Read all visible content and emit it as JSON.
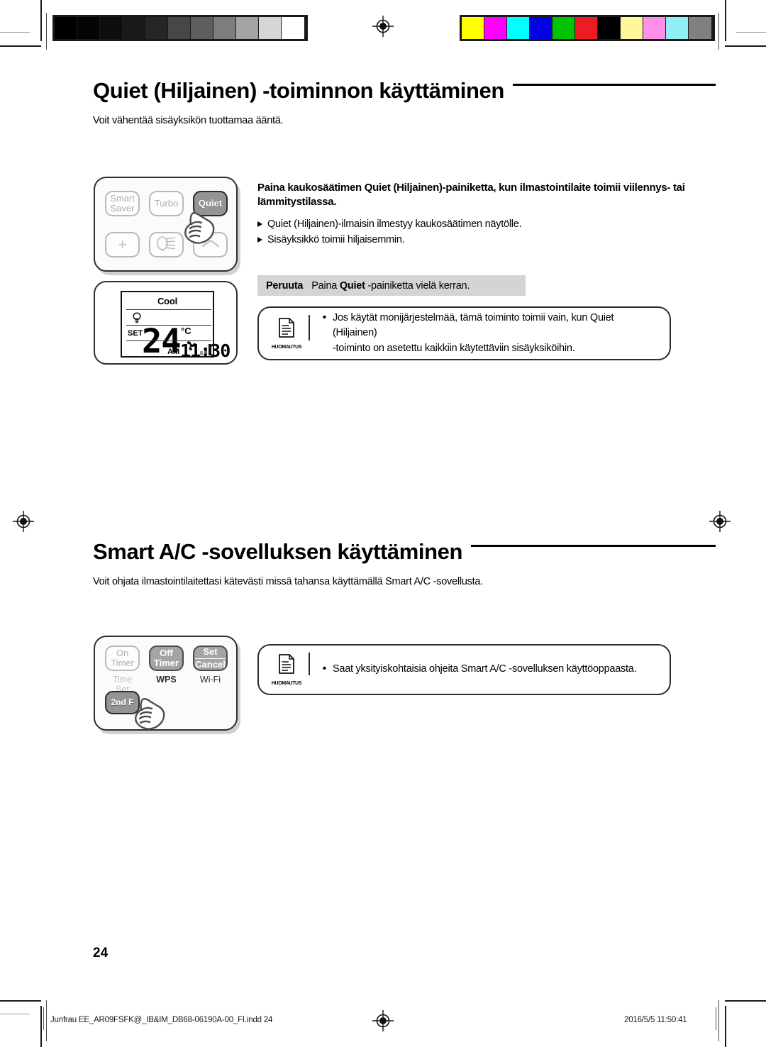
{
  "calibration": {
    "gray_patches": [
      "#000000",
      "#050505",
      "#0d0d0d",
      "#191919",
      "#262626",
      "#474747",
      "#5e5e5e",
      "#7d7d7d",
      "#a3a3a3",
      "#d6d6d6",
      "#ffffff"
    ],
    "color_patches": [
      "#ffff00",
      "#ff00ff",
      "#00ffff",
      "#0000e0",
      "#00c400",
      "#ed1c24",
      "#000000",
      "#fff79a",
      "#ff8fe8",
      "#8ff0f5",
      "#808080"
    ]
  },
  "sections": [
    {
      "id": "quiet",
      "title": "Quiet (Hiljainen) -toiminnon käyttäminen",
      "intro": "Voit vähentää sisäyksikön tuottamaa ääntä.",
      "remote": {
        "buttons_row1": [
          {
            "name": "smart-saver",
            "line1": "Smart",
            "line2": "Saver",
            "state": "inactive"
          },
          {
            "name": "turbo",
            "line1": "Turbo",
            "line2": "",
            "state": "inactive"
          },
          {
            "name": "quiet",
            "line1": "Quiet",
            "line2": "",
            "state": "pressed"
          }
        ],
        "buttons_row2": [
          {
            "name": "plus",
            "glyph": "+",
            "state": "inactive"
          },
          {
            "name": "swing",
            "glyph": "swing-icon",
            "state": "inactive"
          },
          {
            "name": "up",
            "glyph": "chevron-up-icon",
            "state": "inactive"
          }
        ]
      },
      "lcd": {
        "mode": "Cool",
        "indicator": "quiet-indicator-icon",
        "set_label": "SET",
        "temperature": "24",
        "unit": "°C",
        "fan": "fan-icon",
        "fan_level_bars": 3,
        "ampm": "AM",
        "clock": "11:30"
      },
      "lead": "Paina kaukosäätimen Quiet (Hiljainen)-painiketta, kun ilmastointilaite toimii viilennys- tai lämmitystilassa.",
      "lead_bold_parts": [
        "Quiet (Hiljainen)"
      ],
      "bullets": [
        "Quiet (Hiljainen)-ilmaisin ilmestyy kaukosäätimen näytölle.",
        "Sisäyksikkö toimii hiljaisemmin."
      ],
      "cancel": {
        "label": "Peruuta",
        "text_before": "Paina ",
        "text_bold": "Quiet",
        "text_after": " -painiketta vielä kerran."
      },
      "note": {
        "icon_caption": "HUOMAUTUS",
        "lines": [
          "Jos käytät monijärjestelmää, tämä toiminto toimii vain, kun Quiet (Hiljainen)",
          "-toiminto on asetettu kaikkiin käytettäviin sisäyksiköihin."
        ]
      }
    },
    {
      "id": "smart-ac",
      "title": "Smart A/C -sovelluksen käyttäminen",
      "intro": "Voit ohjata ilmastointilaitettasi kätevästi missä tahansa käyttämällä Smart A/C -sovellusta.",
      "remote": {
        "buttons_row1": [
          {
            "name": "on-timer",
            "line1": "On",
            "line2": "Timer",
            "state": "inactive"
          },
          {
            "name": "off-timer",
            "line1": "Off",
            "line2": "Timer",
            "state": "active"
          },
          {
            "name": "set-cancel",
            "line1": "Set",
            "line2": "Cancel",
            "state": "active"
          }
        ],
        "captions": [
          {
            "name": "time-set",
            "text": "Time Set",
            "state": "inactive"
          },
          {
            "name": "wps",
            "text": "WPS",
            "state": "active"
          },
          {
            "name": "wifi",
            "text": "Wi-Fi",
            "state": "active"
          }
        ],
        "buttons_row2": [
          {
            "name": "second-function",
            "line1": "2nd F",
            "line2": "",
            "state": "pressed"
          }
        ]
      },
      "note": {
        "icon_caption": "HUOMAUTUS",
        "lines": [
          "Saat yksityiskohtaisia ohjeita Smart A/C -sovelluksen käyttöoppaasta."
        ]
      }
    }
  ],
  "footer": {
    "page_number": "24",
    "file_name": "Junfrau EE_AR09FSFK@_IB&IM_DB68-06190A-00_FI.indd   24",
    "timestamp": "2016/5/5   11:50:41"
  }
}
